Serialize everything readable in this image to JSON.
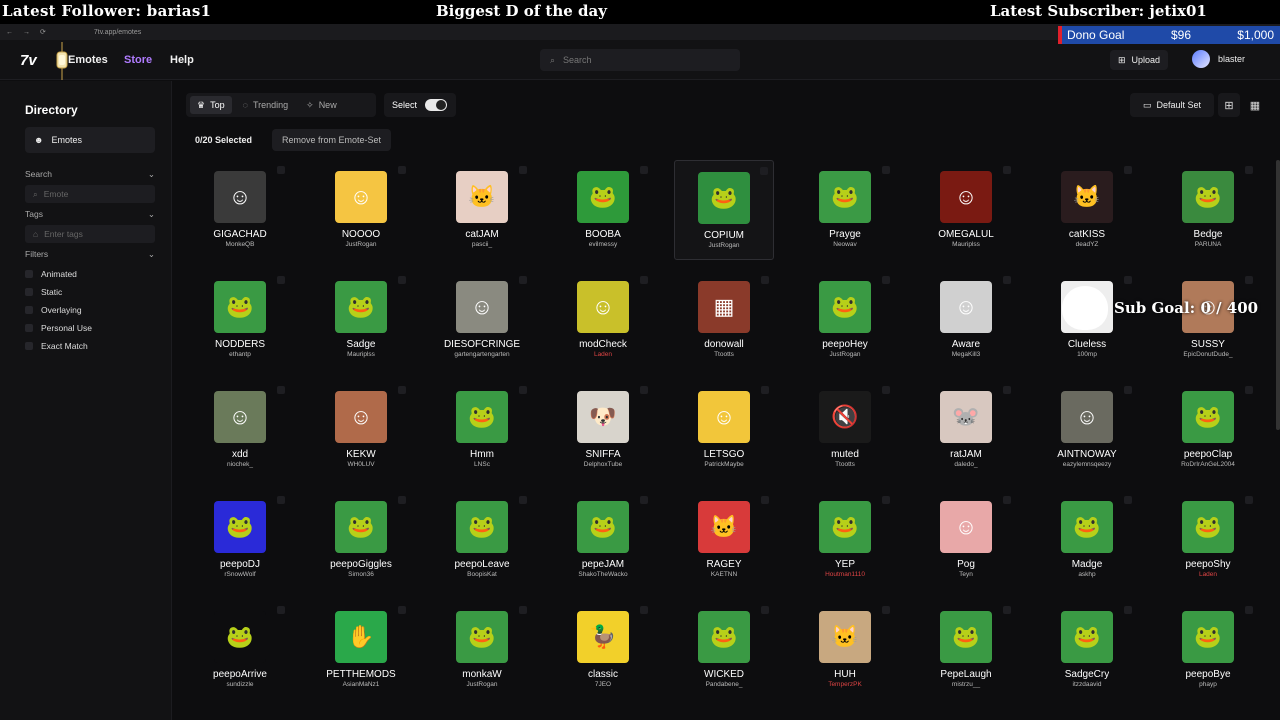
{
  "overlay": {
    "latest_follower": "Latest Follower: barias1",
    "center_text": "Biggest D of the day",
    "latest_subscriber": "Latest Subscriber: jetix01",
    "dono_label": "Dono Goal",
    "dono_current": "$96",
    "dono_goal": "$1,000",
    "dono_progress": 0.096,
    "sub_goal": "Sub Goal: 0 / 400"
  },
  "browser": {
    "url": "7tv.app/emotes"
  },
  "header": {
    "logo": "7v",
    "nav": [
      "Emotes",
      "Store",
      "Help"
    ],
    "search_placeholder": "Search",
    "upload_label": "Upload",
    "username": "blaster"
  },
  "sidebar": {
    "title": "Directory",
    "emotes_label": "Emotes",
    "search_label": "Search",
    "search_placeholder": "Emote",
    "tags_label": "Tags",
    "tags_placeholder": "Enter tags",
    "filters_label": "Filters",
    "filters": [
      "Animated",
      "Static",
      "Overlaying",
      "Personal Use",
      "Exact Match"
    ]
  },
  "toolbar": {
    "top": "Top",
    "trending": "Trending",
    "new": "New",
    "select": "Select",
    "default_set": "Default Set",
    "selected_count": "0/20 Selected",
    "remove_label": "Remove from Emote-Set"
  },
  "emotes": [
    {
      "name": "GIGACHAD",
      "author": "MonkeQB",
      "color": "#3a3a3a",
      "icon": "face-icon"
    },
    {
      "name": "NOOOO",
      "author": "JustRogan",
      "color": "#f5c542",
      "icon": "face-icon"
    },
    {
      "name": "catJAM",
      "author": "pascii_",
      "color": "#e7cfc4",
      "icon": "cat-icon"
    },
    {
      "name": "BOOBA",
      "author": "evilmessy",
      "color": "#2e9a3a",
      "icon": "frog-icon"
    },
    {
      "name": "COPIUM",
      "author": "JustRogan",
      "color": "#2f8f3f",
      "icon": "frog-icon"
    },
    {
      "name": "Prayge",
      "author": "Neowav",
      "color": "#3b9a45",
      "icon": "frog-icon"
    },
    {
      "name": "OMEGALUL",
      "author": "Mauriplss",
      "color": "#7a1a12",
      "icon": "face-icon"
    },
    {
      "name": "catKISS",
      "author": "deadYZ",
      "color": "#2a1c1e",
      "icon": "cat-icon"
    },
    {
      "name": "Bedge",
      "author": "PARUNA",
      "color": "#3a8a3e",
      "icon": "frog-icon"
    },
    {
      "name": "NODDERS",
      "author": "ethantp",
      "color": "#3a9a44",
      "icon": "frog-icon"
    },
    {
      "name": "Sadge",
      "author": "Mauriplss",
      "color": "#3a9a44",
      "icon": "frog-icon"
    },
    {
      "name": "DIESOFCRINGE",
      "author": "gartengartengarten",
      "color": "#8a8a80",
      "icon": "face-icon"
    },
    {
      "name": "modCheck",
      "author": "Laden",
      "color": "#c9c02a",
      "icon": "face-icon"
    },
    {
      "name": "donowall",
      "author": "Ttootts",
      "color": "#8a3a2a",
      "icon": "wall-icon"
    },
    {
      "name": "peepoHey",
      "author": "JustRogan",
      "color": "#3a9a44",
      "icon": "frog-icon"
    },
    {
      "name": "Aware",
      "author": "MegaKill3",
      "color": "#d0d0d0",
      "icon": "face-icon"
    },
    {
      "name": "Clueless",
      "author": "100mp",
      "color": "#eeeeee",
      "icon": "face-icon"
    },
    {
      "name": "SUSSY",
      "author": "EpicDonutDude_",
      "color": "#b07a5a",
      "icon": "face-icon"
    },
    {
      "name": "xdd",
      "author": "niochek_",
      "color": "#6a7a5a",
      "icon": "face-icon"
    },
    {
      "name": "KEKW",
      "author": "WH0LUV",
      "color": "#b06a4a",
      "icon": "face-icon"
    },
    {
      "name": "Hmm",
      "author": "LNSc",
      "color": "#3a9a44",
      "icon": "frog-icon"
    },
    {
      "name": "SNIFFA",
      "author": "DelphoxTube",
      "color": "#d8d4cc",
      "icon": "dog-icon"
    },
    {
      "name": "LETSGO",
      "author": "PatrickMaybe",
      "color": "#f2c63a",
      "icon": "face-icon"
    },
    {
      "name": "muted",
      "author": "Ttootts",
      "color": "#1a1a1a",
      "icon": "speaker-icon"
    },
    {
      "name": "ratJAM",
      "author": "daledo_",
      "color": "#d8c8c0",
      "icon": "rat-icon"
    },
    {
      "name": "AINTNOWAY",
      "author": "eazylemnsqeezy",
      "color": "#6a6a60",
      "icon": "face-icon"
    },
    {
      "name": "peepoClap",
      "author": "RoDrIrAnGeL2004",
      "color": "#3a9a44",
      "icon": "frog-icon"
    },
    {
      "name": "peepoDJ",
      "author": "rSnowWolf",
      "color": "#2a2ad8",
      "icon": "frog-icon"
    },
    {
      "name": "peepoGiggles",
      "author": "Simon36",
      "color": "#3a9a44",
      "icon": "frog-icon"
    },
    {
      "name": "peepoLeave",
      "author": "BoopisKat",
      "color": "#3a9a44",
      "icon": "frog-icon"
    },
    {
      "name": "pepeJAM",
      "author": "ShakoTheWacko",
      "color": "#3a9a44",
      "icon": "frog-icon"
    },
    {
      "name": "RAGEY",
      "author": "KAETNN",
      "color": "#d83a3a",
      "icon": "cat-icon"
    },
    {
      "name": "YEP",
      "author": "Houtman1110",
      "color": "#3a9a44",
      "icon": "frog-icon"
    },
    {
      "name": "Pog",
      "author": "Teyn",
      "color": "#e8a8a8",
      "icon": "face-icon"
    },
    {
      "name": "Madge",
      "author": "askhp",
      "color": "#3a9a44",
      "icon": "frog-icon"
    },
    {
      "name": "peepoShy",
      "author": "Laden",
      "color": "#3a9a44",
      "icon": "frog-icon"
    },
    {
      "name": "peepoArrive",
      "author": "sundizzle",
      "color": "#0d0d0f",
      "icon": "frog-icon"
    },
    {
      "name": "PETTHEMODS",
      "author": "AsianMaNz1",
      "color": "#2aa84a",
      "icon": "hand-icon"
    },
    {
      "name": "monkaW",
      "author": "JustRogan",
      "color": "#3a9a44",
      "icon": "frog-icon"
    },
    {
      "name": "classic",
      "author": "7JEO",
      "color": "#f2d02a",
      "icon": "duck-icon"
    },
    {
      "name": "WICKED",
      "author": "Pandabene_",
      "color": "#3a9a44",
      "icon": "frog-icon"
    },
    {
      "name": "HUH",
      "author": "TemperzPK",
      "color": "#c8a880",
      "icon": "cat-icon"
    },
    {
      "name": "PepeLaugh",
      "author": "mistrzu__",
      "color": "#3a9a44",
      "icon": "frog-icon"
    },
    {
      "name": "SadgeCry",
      "author": "itzzdaavid",
      "color": "#3a9a44",
      "icon": "frog-icon"
    },
    {
      "name": "peepoBye",
      "author": "phayp",
      "color": "#3a9a44",
      "icon": "frog-icon"
    }
  ]
}
